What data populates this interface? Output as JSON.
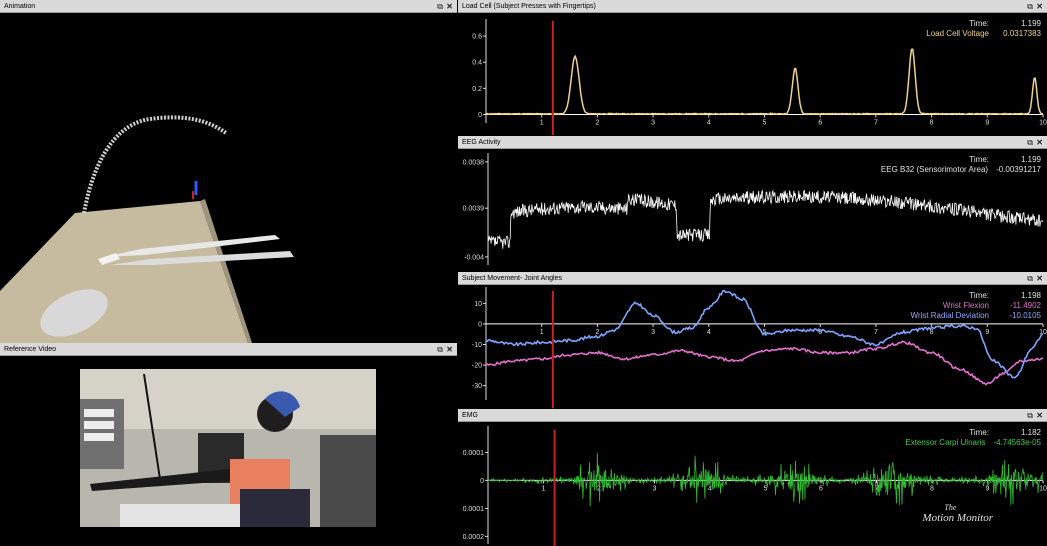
{
  "panels": {
    "animation": {
      "title": "Animation"
    },
    "reference_video": {
      "title": "Reference Video"
    },
    "load_cell": {
      "title": "Load Cell (Subject Presses with Fingertips)",
      "readout": [
        {
          "label": "Time:",
          "value": "1.199",
          "color": "#e0e0e0"
        },
        {
          "label": "Load Cell Voltage",
          "value": "0.0317383",
          "color": "#f0d28a"
        }
      ]
    },
    "eeg": {
      "title": "EEG Activity",
      "readout": [
        {
          "label": "Time:",
          "value": "1.199",
          "color": "#e0e0e0"
        },
        {
          "label": "EEG B32 (Sensorimotor Area)",
          "value": "-0.00391217",
          "color": "#e0e0e0"
        }
      ]
    },
    "movement": {
      "title": "Subject Movement- Joint Angles",
      "readout": [
        {
          "label": "Time:",
          "value": "1.198",
          "color": "#e0e0e0"
        },
        {
          "label": "Wrist Flexion",
          "value": "-11.4902",
          "color": "#e070d0"
        },
        {
          "label": "Wrist Radial Deviation",
          "value": "-10.0105",
          "color": "#8fa8ff"
        }
      ]
    },
    "emg": {
      "title": "EMG",
      "readout": [
        {
          "label": "Time:",
          "value": "1.182",
          "color": "#e0e0e0"
        },
        {
          "label": "Extensor Carpi Ulnaris",
          "value": "-4.74563e-05",
          "color": "#44cc44"
        }
      ]
    }
  },
  "window_controls": {
    "restore": "⧉",
    "close": "✕"
  },
  "logo": {
    "line1": "The",
    "line2": "Motion Monitor"
  },
  "colors": {
    "cursor": "#cc2222",
    "load_cell": "#f0d28a",
    "eeg": "#ffffff",
    "flexion": "#e070d0",
    "radial": "#7ea2ff",
    "emg": "#33bb33"
  },
  "chart_data": [
    {
      "type": "line",
      "name": "load_cell",
      "xlim": [
        0,
        10
      ],
      "ylim": [
        -0.05,
        0.7
      ],
      "x_ticks": [
        "1",
        "2",
        "3",
        "4",
        "5",
        "6",
        "7",
        "8",
        "9",
        "10"
      ],
      "y_ticks": [
        {
          "v": 0,
          "label": "0"
        },
        {
          "v": 0.2,
          "label": "0.2"
        },
        {
          "v": 0.4,
          "label": "0.4"
        },
        {
          "v": 0.6,
          "label": "0.6"
        }
      ],
      "cursor": 1.2,
      "peaks": [
        {
          "x": 1.6,
          "h": 0.44,
          "w": 0.22
        },
        {
          "x": 5.55,
          "h": 0.35,
          "w": 0.16
        },
        {
          "x": 7.65,
          "h": 0.5,
          "w": 0.17
        },
        {
          "x": 9.85,
          "h": 0.28,
          "w": 0.12
        }
      ]
    },
    {
      "type": "line",
      "name": "eeg",
      "xlim": [
        0,
        10
      ],
      "ylim": [
        -0.0045,
        0.0042
      ],
      "y_ticks": [
        {
          "v": 0.0038,
          "label": "0.0038"
        },
        {
          "v": 0.0,
          "label": "0.0039"
        },
        {
          "v": -0.004,
          "label": "-0.004"
        }
      ]
    },
    {
      "type": "line",
      "name": "joint_angles",
      "xlim": [
        0,
        10
      ],
      "ylim": [
        -36,
        16
      ],
      "x_ticks": [
        "1",
        "2",
        "3",
        "4",
        "5",
        "6",
        "7",
        "8",
        "9",
        "10"
      ],
      "y_ticks": [
        {
          "v": 10,
          "label": "10"
        },
        {
          "v": 0,
          "label": "0"
        },
        {
          "v": -10,
          "label": "-10"
        },
        {
          "v": -20,
          "label": "-20"
        },
        {
          "v": -30,
          "label": "-30"
        }
      ],
      "cursor": 1.2
    },
    {
      "type": "line",
      "name": "emg",
      "xlim": [
        0,
        10
      ],
      "ylim": [
        -0.00022,
        0.00018
      ],
      "x_ticks": [
        "1",
        "2",
        "3",
        "4",
        "5",
        "6",
        "7",
        "8",
        "9",
        "10"
      ],
      "y_ticks": [
        {
          "v": 0.0001,
          "label": "0.0001"
        },
        {
          "v": 0,
          "label": "0"
        },
        {
          "v": -0.0001,
          "label": "0.0001"
        },
        {
          "v": -0.0002,
          "label": "0.0002"
        }
      ],
      "cursor": 1.2
    }
  ]
}
